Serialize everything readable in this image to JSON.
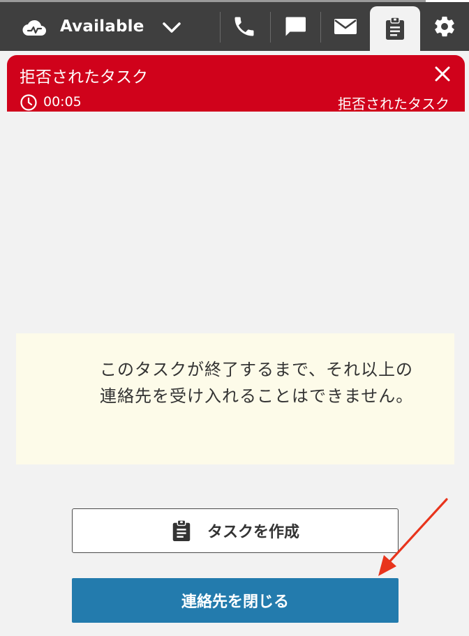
{
  "topbar": {
    "status_label": "Available",
    "icons": [
      "cloud-status-icon",
      "chevron-down-icon",
      "phone-icon",
      "chat-icon",
      "mail-icon",
      "clipboard-icon",
      "gear-icon"
    ]
  },
  "banner": {
    "title": "拒否されたタスク",
    "timer": "00:05",
    "state": "拒否されたタスク",
    "color": "#d0021b"
  },
  "notice": {
    "message": "このタスクが終了するまで、それ以上の連絡先を受け入れることはできません。"
  },
  "buttons": {
    "create_task": "タスクを作成",
    "close_contact": "連絡先を閉じる",
    "primary_color": "#237bad"
  },
  "annotation": {
    "arrow_color": "#e8341c"
  }
}
